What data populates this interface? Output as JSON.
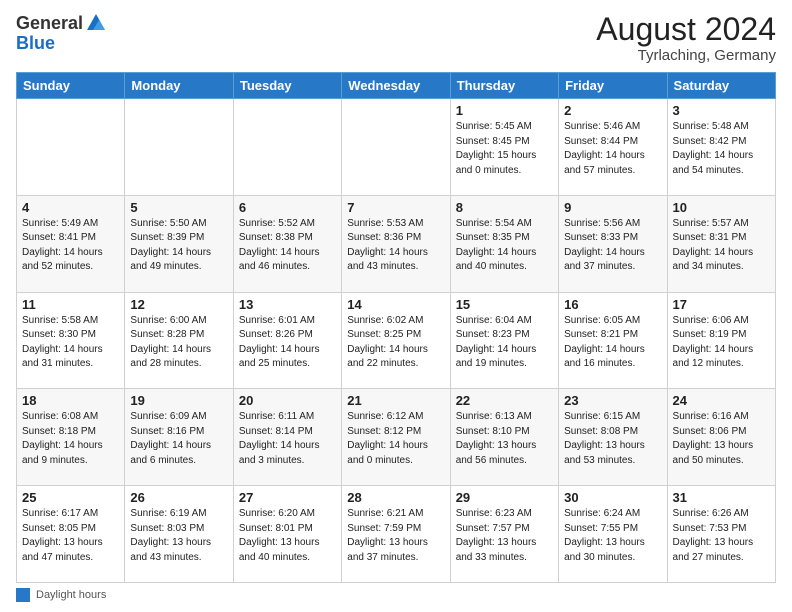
{
  "header": {
    "logo_general": "General",
    "logo_blue": "Blue",
    "month_year": "August 2024",
    "location": "Tyrlaching, Germany"
  },
  "footer": {
    "daylight_label": "Daylight hours"
  },
  "days_of_week": [
    "Sunday",
    "Monday",
    "Tuesday",
    "Wednesday",
    "Thursday",
    "Friday",
    "Saturday"
  ],
  "weeks": [
    [
      {
        "day": "",
        "detail": ""
      },
      {
        "day": "",
        "detail": ""
      },
      {
        "day": "",
        "detail": ""
      },
      {
        "day": "",
        "detail": ""
      },
      {
        "day": "1",
        "detail": "Sunrise: 5:45 AM\nSunset: 8:45 PM\nDaylight: 15 hours\nand 0 minutes."
      },
      {
        "day": "2",
        "detail": "Sunrise: 5:46 AM\nSunset: 8:44 PM\nDaylight: 14 hours\nand 57 minutes."
      },
      {
        "day": "3",
        "detail": "Sunrise: 5:48 AM\nSunset: 8:42 PM\nDaylight: 14 hours\nand 54 minutes."
      }
    ],
    [
      {
        "day": "4",
        "detail": "Sunrise: 5:49 AM\nSunset: 8:41 PM\nDaylight: 14 hours\nand 52 minutes."
      },
      {
        "day": "5",
        "detail": "Sunrise: 5:50 AM\nSunset: 8:39 PM\nDaylight: 14 hours\nand 49 minutes."
      },
      {
        "day": "6",
        "detail": "Sunrise: 5:52 AM\nSunset: 8:38 PM\nDaylight: 14 hours\nand 46 minutes."
      },
      {
        "day": "7",
        "detail": "Sunrise: 5:53 AM\nSunset: 8:36 PM\nDaylight: 14 hours\nand 43 minutes."
      },
      {
        "day": "8",
        "detail": "Sunrise: 5:54 AM\nSunset: 8:35 PM\nDaylight: 14 hours\nand 40 minutes."
      },
      {
        "day": "9",
        "detail": "Sunrise: 5:56 AM\nSunset: 8:33 PM\nDaylight: 14 hours\nand 37 minutes."
      },
      {
        "day": "10",
        "detail": "Sunrise: 5:57 AM\nSunset: 8:31 PM\nDaylight: 14 hours\nand 34 minutes."
      }
    ],
    [
      {
        "day": "11",
        "detail": "Sunrise: 5:58 AM\nSunset: 8:30 PM\nDaylight: 14 hours\nand 31 minutes."
      },
      {
        "day": "12",
        "detail": "Sunrise: 6:00 AM\nSunset: 8:28 PM\nDaylight: 14 hours\nand 28 minutes."
      },
      {
        "day": "13",
        "detail": "Sunrise: 6:01 AM\nSunset: 8:26 PM\nDaylight: 14 hours\nand 25 minutes."
      },
      {
        "day": "14",
        "detail": "Sunrise: 6:02 AM\nSunset: 8:25 PM\nDaylight: 14 hours\nand 22 minutes."
      },
      {
        "day": "15",
        "detail": "Sunrise: 6:04 AM\nSunset: 8:23 PM\nDaylight: 14 hours\nand 19 minutes."
      },
      {
        "day": "16",
        "detail": "Sunrise: 6:05 AM\nSunset: 8:21 PM\nDaylight: 14 hours\nand 16 minutes."
      },
      {
        "day": "17",
        "detail": "Sunrise: 6:06 AM\nSunset: 8:19 PM\nDaylight: 14 hours\nand 12 minutes."
      }
    ],
    [
      {
        "day": "18",
        "detail": "Sunrise: 6:08 AM\nSunset: 8:18 PM\nDaylight: 14 hours\nand 9 minutes."
      },
      {
        "day": "19",
        "detail": "Sunrise: 6:09 AM\nSunset: 8:16 PM\nDaylight: 14 hours\nand 6 minutes."
      },
      {
        "day": "20",
        "detail": "Sunrise: 6:11 AM\nSunset: 8:14 PM\nDaylight: 14 hours\nand 3 minutes."
      },
      {
        "day": "21",
        "detail": "Sunrise: 6:12 AM\nSunset: 8:12 PM\nDaylight: 14 hours\nand 0 minutes."
      },
      {
        "day": "22",
        "detail": "Sunrise: 6:13 AM\nSunset: 8:10 PM\nDaylight: 13 hours\nand 56 minutes."
      },
      {
        "day": "23",
        "detail": "Sunrise: 6:15 AM\nSunset: 8:08 PM\nDaylight: 13 hours\nand 53 minutes."
      },
      {
        "day": "24",
        "detail": "Sunrise: 6:16 AM\nSunset: 8:06 PM\nDaylight: 13 hours\nand 50 minutes."
      }
    ],
    [
      {
        "day": "25",
        "detail": "Sunrise: 6:17 AM\nSunset: 8:05 PM\nDaylight: 13 hours\nand 47 minutes."
      },
      {
        "day": "26",
        "detail": "Sunrise: 6:19 AM\nSunset: 8:03 PM\nDaylight: 13 hours\nand 43 minutes."
      },
      {
        "day": "27",
        "detail": "Sunrise: 6:20 AM\nSunset: 8:01 PM\nDaylight: 13 hours\nand 40 minutes."
      },
      {
        "day": "28",
        "detail": "Sunrise: 6:21 AM\nSunset: 7:59 PM\nDaylight: 13 hours\nand 37 minutes."
      },
      {
        "day": "29",
        "detail": "Sunrise: 6:23 AM\nSunset: 7:57 PM\nDaylight: 13 hours\nand 33 minutes."
      },
      {
        "day": "30",
        "detail": "Sunrise: 6:24 AM\nSunset: 7:55 PM\nDaylight: 13 hours\nand 30 minutes."
      },
      {
        "day": "31",
        "detail": "Sunrise: 6:26 AM\nSunset: 7:53 PM\nDaylight: 13 hours\nand 27 minutes."
      }
    ]
  ]
}
